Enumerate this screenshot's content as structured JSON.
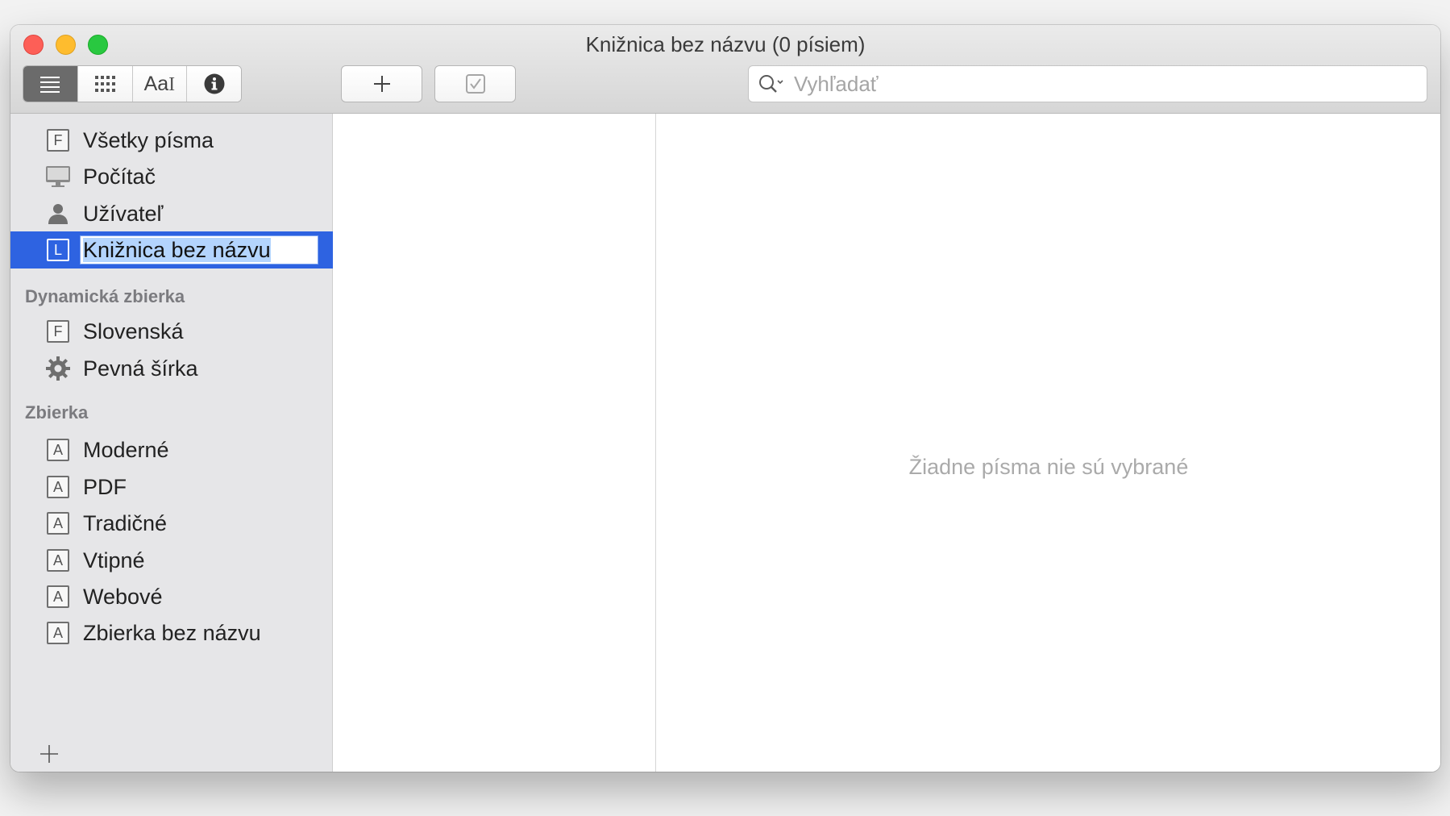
{
  "window": {
    "title": "Knižnica bez názvu (0 písiem)"
  },
  "toolbar": {
    "view_buttons": [
      {
        "name": "list-view",
        "icon": "list-icon",
        "active": true
      },
      {
        "name": "grid-view",
        "icon": "grid-icon",
        "active": false
      },
      {
        "name": "sample-view",
        "icon": "font-sample-icon",
        "label": "Aa",
        "active": false
      },
      {
        "name": "info-view",
        "icon": "info-icon",
        "active": false
      }
    ],
    "add_button_icon": "plus-icon",
    "validate_button_icon": "checkbox-icon",
    "search": {
      "placeholder": "Vyhľadať",
      "value": ""
    }
  },
  "sidebar": {
    "libraries": [
      {
        "label": "Všetky písma",
        "icon": "font-box-icon",
        "letter": "F"
      },
      {
        "label": "Počítač",
        "icon": "computer-icon"
      },
      {
        "label": "Užívateľ",
        "icon": "user-icon"
      },
      {
        "label": "Knižnica bez názvu",
        "icon": "library-box-icon",
        "letter": "L",
        "selected": true,
        "editing": true
      }
    ],
    "smart_header": "Dynamická zbierka",
    "smart_collections": [
      {
        "label": "Slovenská",
        "icon": "font-box-icon",
        "letter": "F"
      },
      {
        "label": "Pevná šírka",
        "icon": "gear-icon"
      }
    ],
    "collections_header": "Zbierka",
    "collections": [
      {
        "label": "Moderné",
        "icon": "collection-box-icon",
        "letter": "A"
      },
      {
        "label": "PDF",
        "icon": "collection-box-icon",
        "letter": "A"
      },
      {
        "label": "Tradičné",
        "icon": "collection-box-icon",
        "letter": "A"
      },
      {
        "label": "Vtipné",
        "icon": "collection-box-icon",
        "letter": "A"
      },
      {
        "label": "Webové",
        "icon": "collection-box-icon",
        "letter": "A"
      },
      {
        "label": "Zbierka bez názvu",
        "icon": "collection-box-icon",
        "letter": "A"
      }
    ]
  },
  "preview": {
    "empty_message": "Žiadne písma nie sú vybrané"
  },
  "colors": {
    "selection": "#2e63e1",
    "sidebar_bg": "#e6e6e8"
  }
}
